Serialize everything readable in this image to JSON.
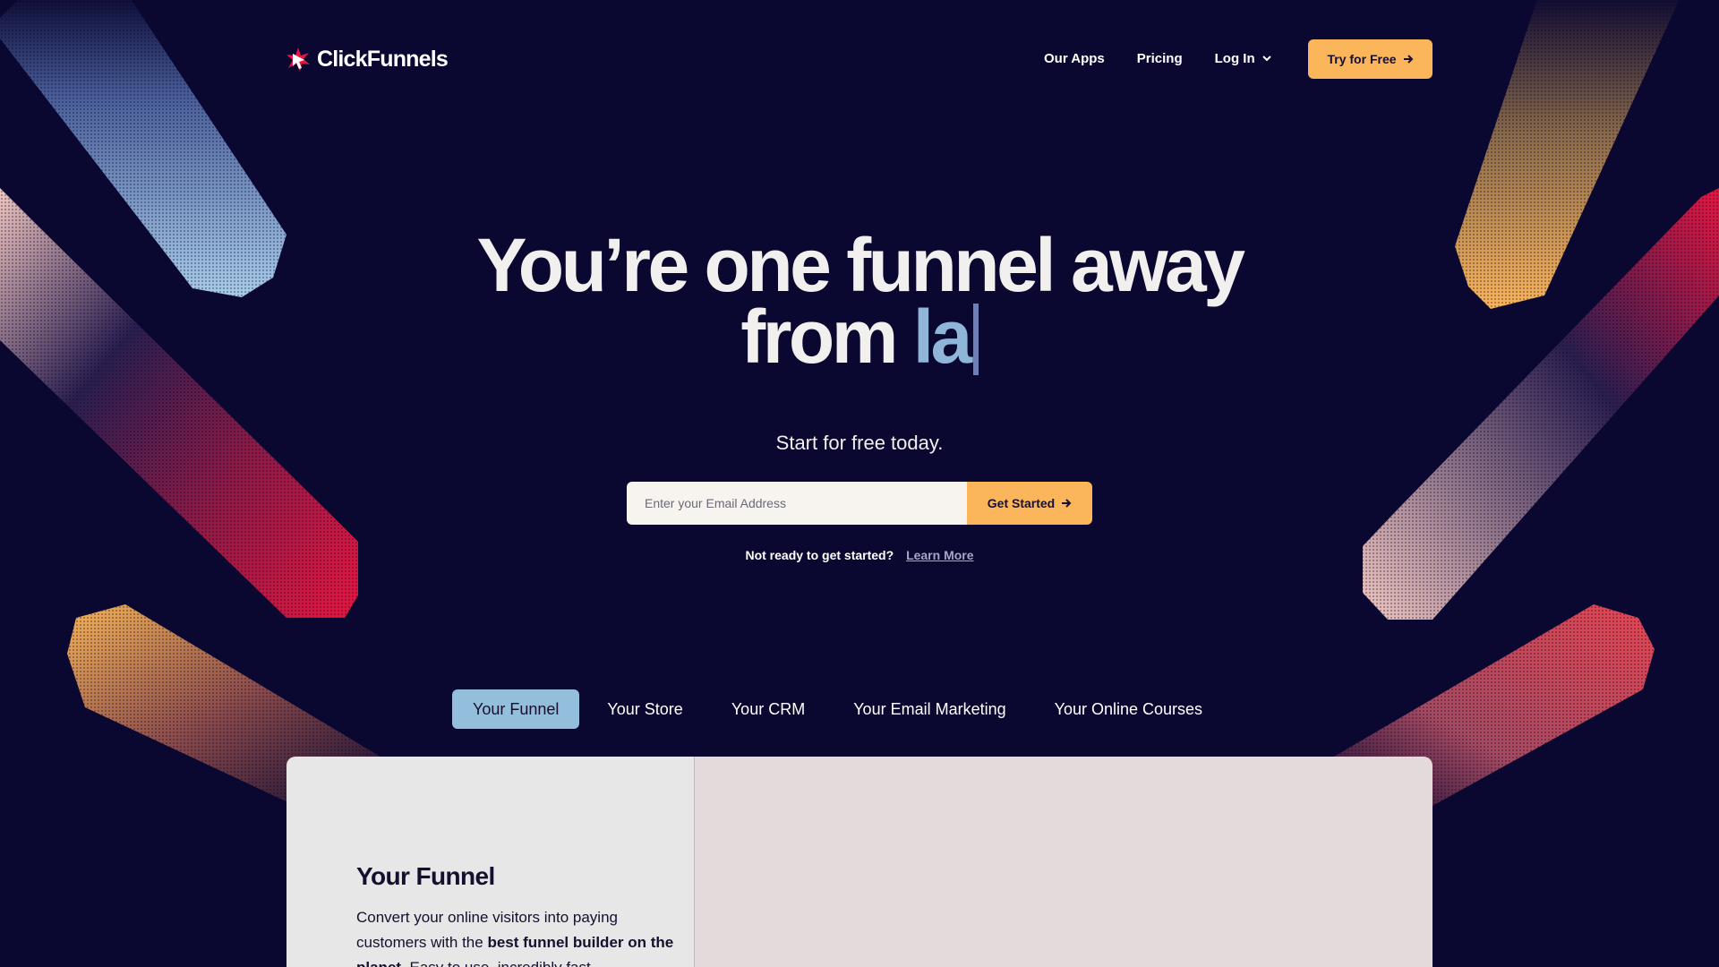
{
  "nav": {
    "logo_text": "ClickFunnels",
    "links": [
      "Our Apps",
      "Pricing",
      "Log In"
    ],
    "cta_label": "Try for Free"
  },
  "hero": {
    "title_line1": "You’re one funnel away",
    "title_line2_prefix": "from ",
    "typed_text": "la",
    "subhead": "Start for free today.",
    "email_placeholder": "Enter your Email Address",
    "get_started_label": "Get Started",
    "not_ready_text": "Not ready to get started?",
    "learn_more_label": "Learn More"
  },
  "tabs": [
    {
      "label": "Your Funnel",
      "active": true
    },
    {
      "label": "Your Store",
      "active": false
    },
    {
      "label": "Your CRM",
      "active": false
    },
    {
      "label": "Your Email Marketing",
      "active": false
    },
    {
      "label": "Your Online Courses",
      "active": false
    }
  ],
  "panel": {
    "title": "Your Funnel",
    "desc_part1": "Convert your online visitors into paying customers with the ",
    "desc_bold": "best funnel builder on the planet",
    "desc_part2": ". Easy to use, incredibly fast"
  },
  "colors": {
    "background": "#0a0730",
    "accent": "#fbb55a",
    "active_tab": "#93bfdc",
    "typed_text": "#8fb5d8"
  },
  "icons": [
    "clickfunnels-logo-icon",
    "chevron-down-icon",
    "arrow-right-icon"
  ]
}
